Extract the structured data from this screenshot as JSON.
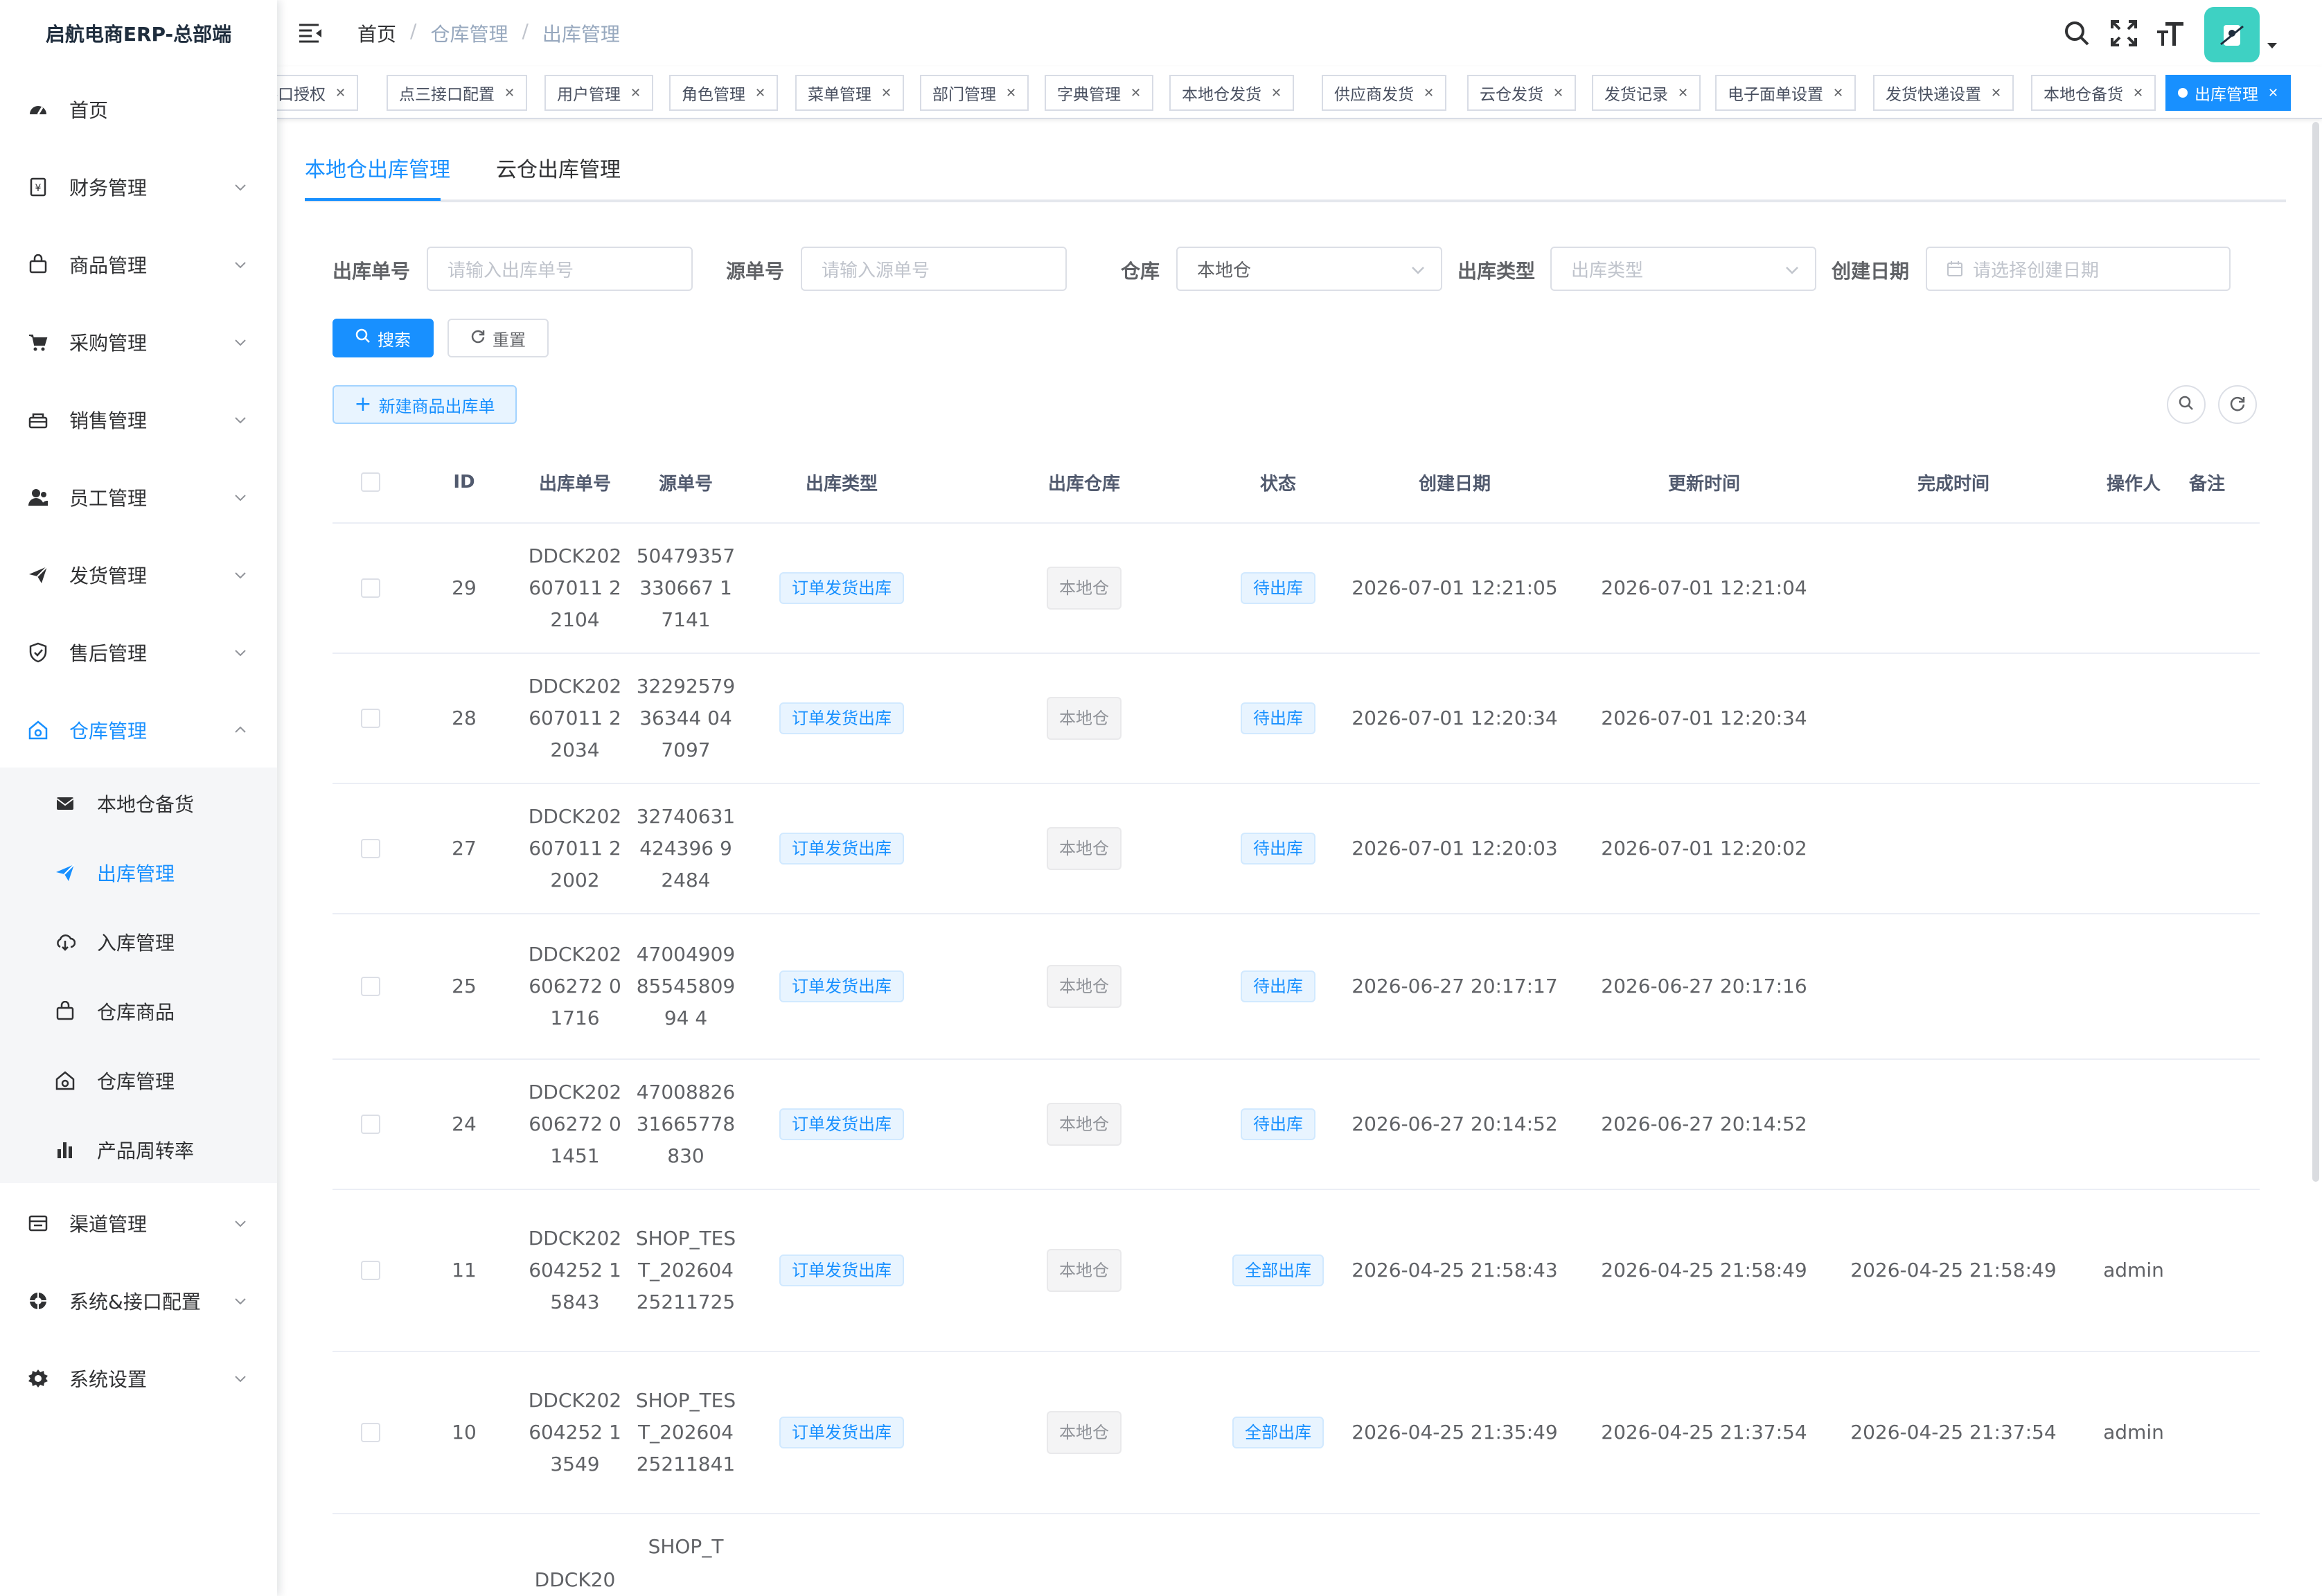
{
  "app": {
    "title": "启航电商ERP-总部端"
  },
  "sidebar": {
    "items": [
      {
        "label": "首页",
        "icon": "dashboard-icon"
      },
      {
        "label": "财务管理",
        "icon": "finance-icon"
      },
      {
        "label": "商品管理",
        "icon": "goods-icon"
      },
      {
        "label": "采购管理",
        "icon": "cart-icon"
      },
      {
        "label": "销售管理",
        "icon": "sales-icon"
      },
      {
        "label": "员工管理",
        "icon": "user-icon"
      },
      {
        "label": "发货管理",
        "icon": "send-icon"
      },
      {
        "label": "售后管理",
        "icon": "shield-icon"
      },
      {
        "label": "仓库管理",
        "icon": "warehouse-icon"
      },
      {
        "label": "渠道管理",
        "icon": "channel-icon"
      },
      {
        "label": "系统&接口配置",
        "icon": "config-icon"
      },
      {
        "label": "系统设置",
        "icon": "gear-icon"
      }
    ],
    "warehouse_sub": [
      {
        "label": "本地仓备货",
        "icon": "mail-icon"
      },
      {
        "label": "出库管理",
        "icon": "send-icon"
      },
      {
        "label": "入库管理",
        "icon": "cloud-download-icon"
      },
      {
        "label": "仓库商品",
        "icon": "goods-icon"
      },
      {
        "label": "仓库管理",
        "icon": "warehouse-icon"
      },
      {
        "label": "产品周转率",
        "icon": "bar-chart-icon"
      }
    ]
  },
  "header": {
    "breadcrumb": [
      "首页",
      "仓库管理",
      "出库管理"
    ]
  },
  "tags": [
    {
      "label": "接口授权"
    },
    {
      "label": "点三接口配置"
    },
    {
      "label": "用户管理"
    },
    {
      "label": "角色管理"
    },
    {
      "label": "菜单管理"
    },
    {
      "label": "部门管理"
    },
    {
      "label": "字典管理"
    },
    {
      "label": "本地仓发货"
    },
    {
      "label": "供应商发货"
    },
    {
      "label": "云仓发货"
    },
    {
      "label": "发货记录"
    },
    {
      "label": "电子面单设置"
    },
    {
      "label": "发货快递设置"
    },
    {
      "label": "本地仓备货"
    },
    {
      "label": "出库管理"
    }
  ],
  "tabs": [
    "本地仓出库管理",
    "云仓出库管理"
  ],
  "filters": {
    "outbound_no": {
      "label": "出库单号",
      "placeholder": "请输入出库单号"
    },
    "source_no": {
      "label": "源单号",
      "placeholder": "请输入源单号"
    },
    "warehouse": {
      "label": "仓库",
      "value": "本地仓"
    },
    "out_type": {
      "label": "出库类型",
      "placeholder": "出库类型"
    },
    "created_date": {
      "label": "创建日期",
      "placeholder": "请选择创建日期"
    }
  },
  "buttons": {
    "search": "搜索",
    "reset": "重置",
    "create": "新建商品出库单"
  },
  "table": {
    "columns": [
      "ID",
      "出库单号",
      "源单号",
      "出库类型",
      "出库仓库",
      "状态",
      "创建日期",
      "更新时间",
      "完成时间",
      "操作人",
      "备注"
    ],
    "rows": [
      {
        "id": "29",
        "out_no": "DDCK202607011 22104",
        "src": "50479357330667 17141",
        "type": "订单发货出库",
        "wh": "本地仓",
        "status": "待出库",
        "created": "2026-07-01 12:21:05",
        "updated": "2026-07-01 12:21:04",
        "done": "",
        "op": ""
      },
      {
        "id": "28",
        "out_no": "DDCK202607011 22034",
        "src": "3229257936344 047097",
        "type": "订单发货出库",
        "wh": "本地仓",
        "status": "待出库",
        "created": "2026-07-01 12:20:34",
        "updated": "2026-07-01 12:20:34",
        "done": "",
        "op": ""
      },
      {
        "id": "27",
        "out_no": "DDCK202607011 22002",
        "src": "32740631424396 92484",
        "type": "订单发货出库",
        "wh": "本地仓",
        "status": "待出库",
        "created": "2026-07-01 12:20:03",
        "updated": "2026-07-01 12:20:02",
        "done": "",
        "op": ""
      },
      {
        "id": "25",
        "out_no": "DDCK202606272 01716",
        "src": "470049098554580994 4",
        "type": "订单发货出库",
        "wh": "本地仓",
        "status": "待出库",
        "created": "2026-06-27 20:17:17",
        "updated": "2026-06-27 20:17:16",
        "done": "",
        "op": ""
      },
      {
        "id": "24",
        "out_no": "DDCK202606272 01451",
        "src": "4700882631665778830",
        "type": "订单发货出库",
        "wh": "本地仓",
        "status": "待出库",
        "created": "2026-06-27 20:14:52",
        "updated": "2026-06-27 20:14:52",
        "done": "",
        "op": ""
      },
      {
        "id": "11",
        "out_no": "DDCK202604252 15843",
        "src": "SHOP_TEST_20260425211725",
        "type": "订单发货出库",
        "wh": "本地仓",
        "status": "全部出库",
        "created": "2026-04-25 21:58:43",
        "updated": "2026-04-25 21:58:49",
        "done": "2026-04-25 21:58:49",
        "op": "admin"
      },
      {
        "id": "10",
        "out_no": "DDCK202604252 13549",
        "src": "SHOP_TEST_20260425211841",
        "type": "订单发货出库",
        "wh": "本地仓",
        "status": "全部出库",
        "created": "2026-04-25 21:35:49",
        "updated": "2026-04-25 21:37:54",
        "done": "2026-04-25 21:37:54",
        "op": "admin"
      },
      {
        "id": "",
        "out_no": "DDCK20",
        "src": "SHOP_T",
        "type": "",
        "wh": "",
        "status": "",
        "created": "",
        "updated": "",
        "done": "",
        "op": ""
      }
    ]
  }
}
